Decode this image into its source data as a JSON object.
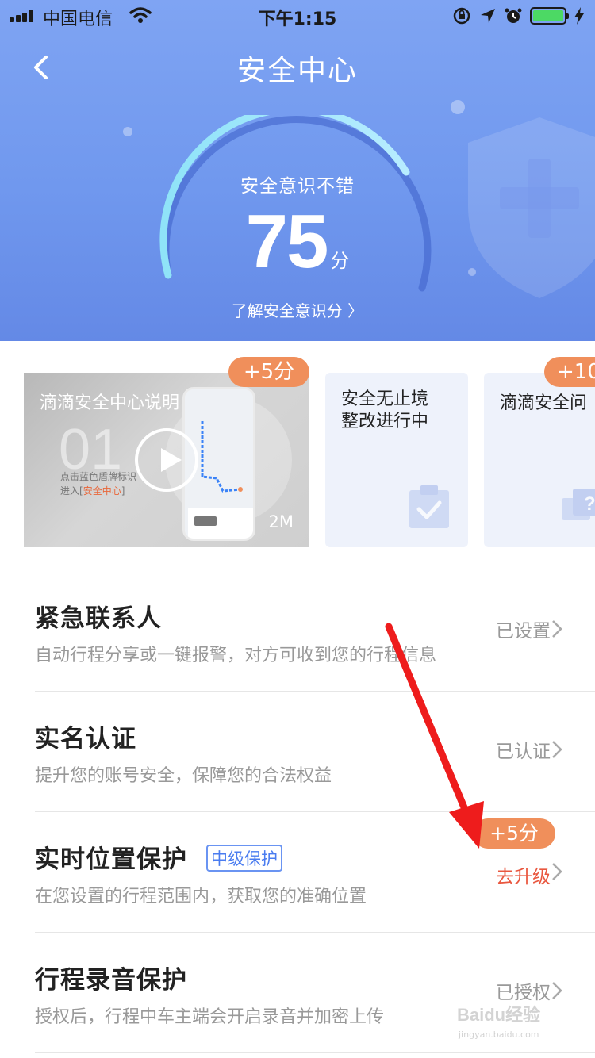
{
  "status_bar": {
    "carrier": "中国电信",
    "time": "下午1:15"
  },
  "header": {
    "title": "安全中心",
    "score_label": "安全意识不错",
    "score": "75",
    "score_unit": "分",
    "score_link": "了解安全意识分 〉"
  },
  "cards": {
    "video": {
      "title": "滴滴安全中心说明",
      "number": "01",
      "hint_line1": "点击蓝色盾牌标识",
      "hint_line2_prefix": "进入[",
      "hint_line2_highlight": "安全中心",
      "hint_line2_suffix": "]",
      "size": "2M",
      "badge": "+5分"
    },
    "card2": {
      "line1": "安全无止境",
      "line2": "整改进行中"
    },
    "card3": {
      "title": "滴滴安全问",
      "badge": "+10"
    }
  },
  "list": {
    "items": [
      {
        "title": "紧急联系人",
        "desc": "自动行程分享或一键报警，对方可收到您的行程信息",
        "status": "已设置"
      },
      {
        "title": "实名认证",
        "desc": "提升您的账号安全，保障您的合法权益",
        "status": "已认证"
      },
      {
        "title": "实时位置保护",
        "tag": "中级保护",
        "desc": "在您设置的行程范围内，获取您的准确位置",
        "status": "去升级",
        "badge": "+5分"
      },
      {
        "title": "行程录音保护",
        "desc": "授权后，行程中车主端会开启录音并加密上传",
        "status": "已授权"
      }
    ]
  },
  "watermark": {
    "text": "Baidu经验",
    "url": "jingyan.baidu.com"
  },
  "colors": {
    "header_top": "#7fa4f3",
    "header_bottom": "#6489e6",
    "badge_orange": "#f08f5b",
    "warn_red": "#e9573f",
    "tag_blue": "#4a7cf0"
  }
}
